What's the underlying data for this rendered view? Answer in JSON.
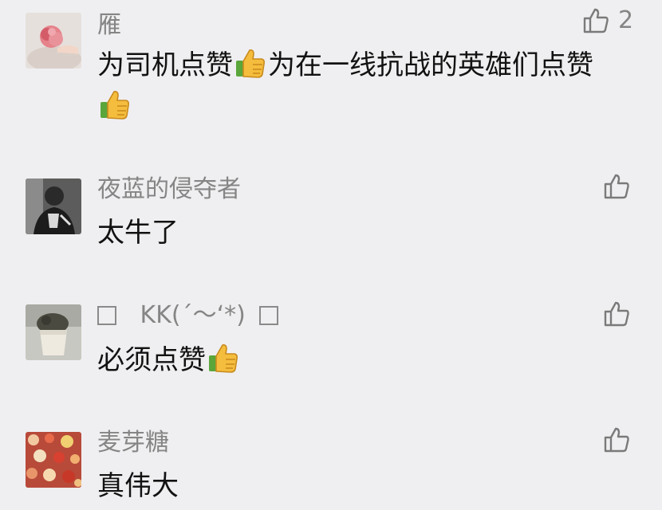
{
  "comments": [
    {
      "name": "雁",
      "text_parts": [
        "为司机点赞",
        "为在一线抗战的英雄们点赞"
      ],
      "likes": "2",
      "avatar": "pink-flower-avatar"
    },
    {
      "name": "夜蓝的侵夺者",
      "text": "太牛了",
      "avatar": "person-portrait-avatar"
    },
    {
      "name": "KK(´～‘*)",
      "text": "必须点赞",
      "avatar": "plant-pot-avatar"
    },
    {
      "name": "麦芽糖",
      "text": "真伟大",
      "avatar": "confetti-candy-avatar"
    }
  ],
  "icons": {
    "like": "thumbs-up-outline-icon",
    "emoji": "thumbs-up-emoji"
  }
}
